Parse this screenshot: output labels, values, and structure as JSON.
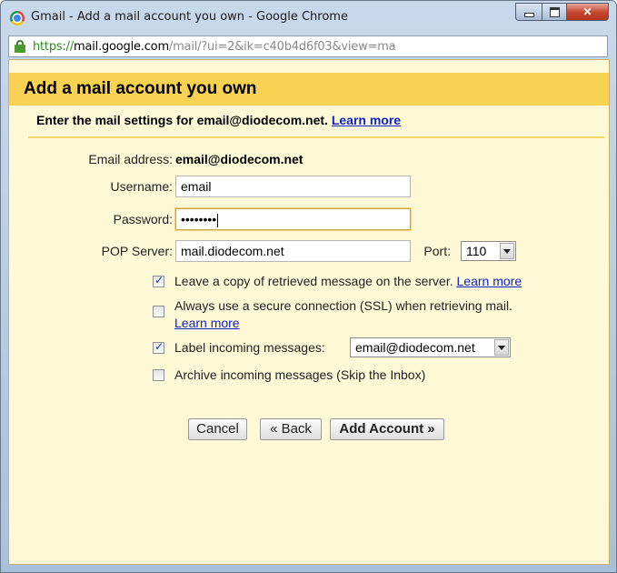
{
  "window": {
    "title": "Gmail - Add a mail account you own - Google Chrome",
    "controls": [
      "minimize",
      "maximize",
      "close"
    ]
  },
  "addressbar": {
    "scheme": "https://",
    "host": "mail.google.com",
    "path": "/mail/?ui=2&ik=c40b4d6f03&view=ma",
    "icon": "lock-icon"
  },
  "dialog": {
    "title": "Add a mail account you own",
    "instructions": "Enter the mail settings for email@diodecom.net.",
    "instructions_link": "Learn more",
    "email_label": "Email address:",
    "email_value": "email@diodecom.net",
    "username_label": "Username:",
    "username_value": "email",
    "password_label": "Password:",
    "password_value": "••••••••",
    "pop_label": "POP Server:",
    "pop_value": "mail.diodecom.net",
    "port_label": "Port:",
    "port_value": "110",
    "options": [
      {
        "label": "Leave a copy of retrieved message on the server.",
        "link": "Learn more",
        "checked": true
      },
      {
        "label": "Always use a secure connection (SSL) when retrieving mail.",
        "link": "Learn more",
        "checked": false
      },
      {
        "label": "Label incoming messages:",
        "select_value": "email@diodecom.net",
        "checked": true
      },
      {
        "label": "Archive incoming messages (Skip the Inbox)",
        "checked": false
      }
    ],
    "buttons": {
      "cancel": "Cancel",
      "back": "« Back",
      "add": "Add Account »"
    }
  },
  "colors": {
    "header_bg": "#f9d251",
    "content_bg": "#fdf9d6",
    "link": "#1122cc"
  }
}
